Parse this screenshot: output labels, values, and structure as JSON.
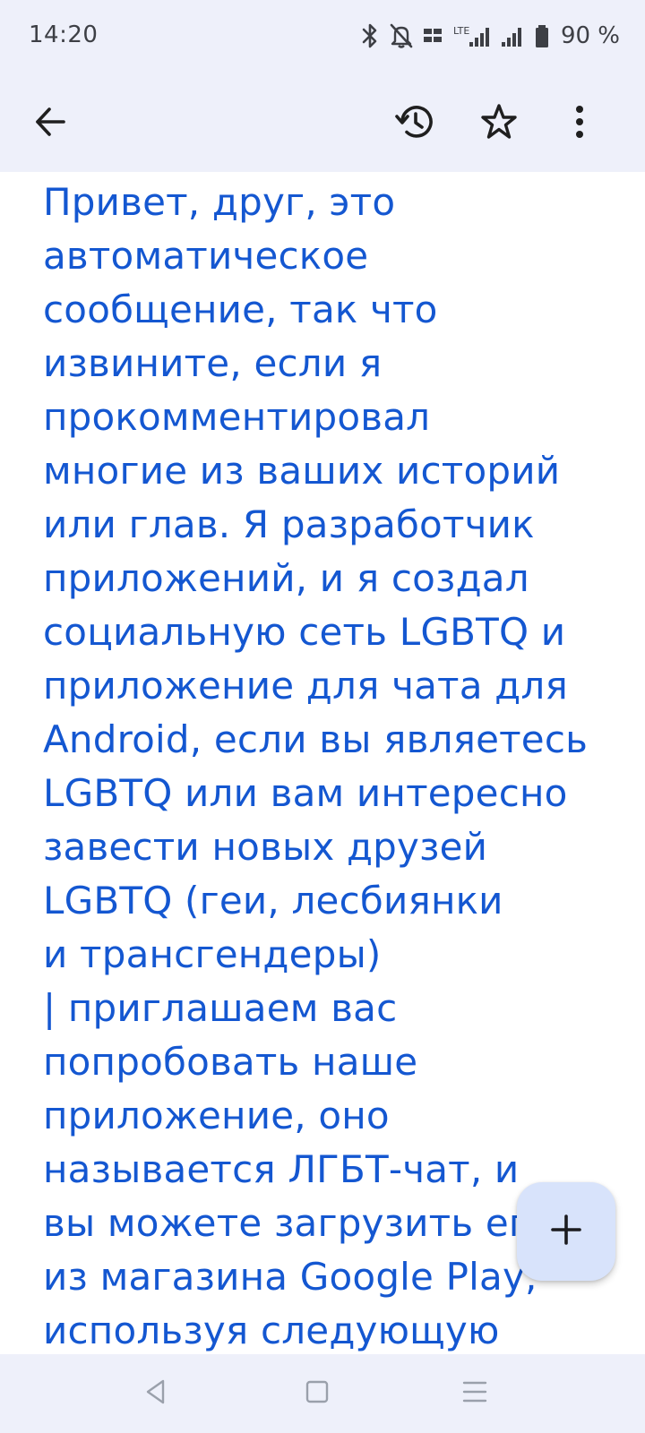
{
  "status_bar": {
    "time": "14:20",
    "battery_percent": "90 %",
    "icons": [
      "bluetooth-icon",
      "notifications-off-icon",
      "volte-icon",
      "lte-signal-icon",
      "signal-icon",
      "battery-icon"
    ]
  },
  "app_bar": {
    "icons": [
      "back-arrow-icon",
      "history-icon",
      "star-icon",
      "more-vert-icon"
    ]
  },
  "note": {
    "text": "Привет, друг, это\nавтоматическое\nсообщение, так что\nизвините, если я\nпрокомментировал\nмногие из ваших историй\nили глав.  Я разработчик\nприложений, и я создал\nсоциальную сеть LGBTQ и\nприложение для чата для\nAndroid, если вы являетесь\nLGBTQ или вам интересно\nзавести новых друзей\nLGBTQ (геи, лесбиянки\nи трансгендеры)\n|  приглашаем вас\nпопробовать наше\nприложение, оно\nназывается ЛГБТ-чат, и\nвы можете загрузить его\nиз магазина Google Play,\nиспользуя следующую",
    "color": "#1457d1"
  },
  "fab": {
    "icon": "plus-icon",
    "background": "#d8e3fb"
  },
  "nav_bar": {
    "icons": [
      "nav-back-icon",
      "nav-home-icon",
      "nav-recents-icon"
    ]
  },
  "colors": {
    "bars": "#eef0fa",
    "icon": "#3d3f45"
  }
}
